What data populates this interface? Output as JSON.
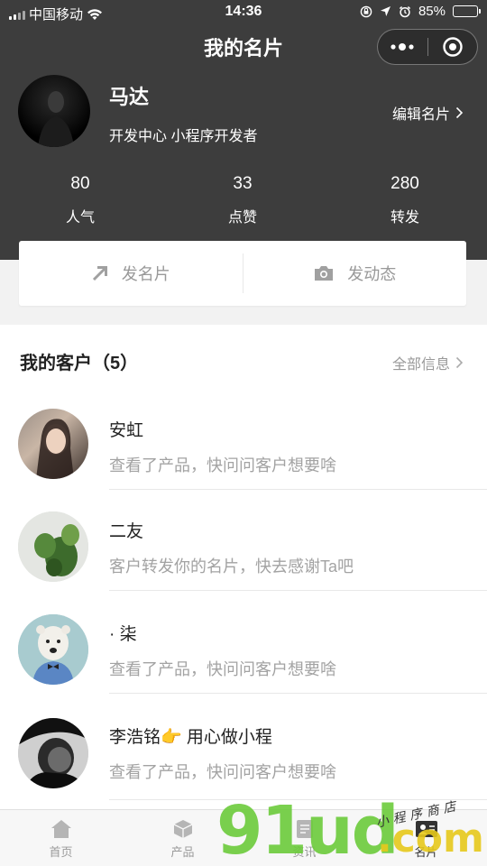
{
  "status_bar": {
    "carrier": "中国移动",
    "time": "14:36",
    "battery": "85%",
    "battery_level": 0.85
  },
  "nav": {
    "title": "我的名片"
  },
  "profile": {
    "name": "马达",
    "description": "开发中心 小程序开发者",
    "edit_label": "编辑名片"
  },
  "stats": [
    {
      "value": "80",
      "label": "人气"
    },
    {
      "value": "33",
      "label": "点赞"
    },
    {
      "value": "280",
      "label": "转发"
    }
  ],
  "actions": {
    "send_card": "发名片",
    "post_moment": "发动态"
  },
  "customers": {
    "title": "我的客户（5）",
    "all_label": "全部信息",
    "items": [
      {
        "name": "安虹",
        "message": "查看了产品，快问问客户想要啥"
      },
      {
        "name": "· 柒",
        "message": "客户转发你的名片，快去感谢Ta吧",
        "name_alt": "二友"
      },
      {
        "name": "· 柒",
        "message": "查看了产品，快问问客户想要啥"
      },
      {
        "name": "李浩铭👉 用心做小程",
        "message": "查看了产品，快问问客户想要啥"
      }
    ]
  },
  "tabbar": [
    {
      "label": "首页",
      "icon": "home-icon"
    },
    {
      "label": "产品",
      "icon": "cube-icon"
    },
    {
      "label": "资讯",
      "icon": "news-icon"
    },
    {
      "label": "名片",
      "icon": "card-icon"
    }
  ],
  "watermark": {
    "brand": "91ud",
    "domain": ".com",
    "tagline": "小程序商店"
  },
  "colors": {
    "header_bg": "#3d3d3d",
    "watermark_green": "#6ccb3b",
    "watermark_yellow": "#e7c91c"
  }
}
